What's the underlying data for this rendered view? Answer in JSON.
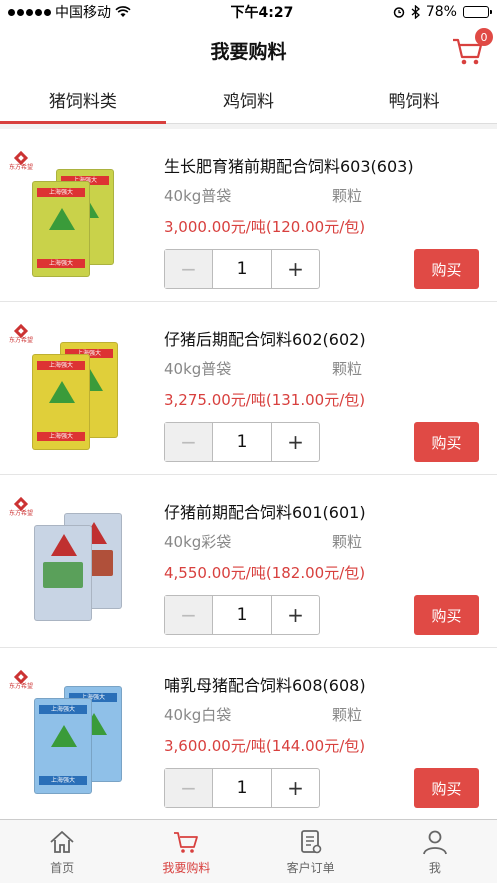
{
  "status": {
    "carrier": "中国移动",
    "time": "下午4:27",
    "battery": "78%",
    "battery_level": 0.78
  },
  "nav": {
    "title": "我要购料",
    "cart_count": "0"
  },
  "tabs": [
    {
      "label": "猪饲料类",
      "active": true
    },
    {
      "label": "鸡饲料",
      "active": false
    },
    {
      "label": "鸭饲料",
      "active": false
    }
  ],
  "products": [
    {
      "title": "生长肥育猪前期配合饲料603(603)",
      "spec": "40kg普袋",
      "form": "颗粒",
      "price": "3,000.00元/吨(120.00元/包)",
      "qty": "1",
      "buy": "购买",
      "brand": "东方希望",
      "bag_label": "上海强大",
      "bag_color": "#c9d24a"
    },
    {
      "title": "仔猪后期配合饲料602(602)",
      "spec": "40kg普袋",
      "form": "颗粒",
      "price": "3,275.00元/吨(131.00元/包)",
      "qty": "1",
      "buy": "购买",
      "brand": "东方希望",
      "bag_label": "上海强大",
      "bag_color": "#e0cf3a"
    },
    {
      "title": "仔猪前期配合饲料601(601)",
      "spec": "40kg彩袋",
      "form": "颗粒",
      "price": "4,550.00元/吨(182.00元/包)",
      "qty": "1",
      "buy": "购买",
      "brand": "东方希望",
      "bag_label": "",
      "bag_color": "#c8d4e4"
    },
    {
      "title": "哺乳母猪配合饲料608(608)",
      "spec": "40kg白袋",
      "form": "颗粒",
      "price": "3,600.00元/吨(144.00元/包)",
      "qty": "1",
      "buy": "购买",
      "brand": "东方希望",
      "bag_label": "上海强大",
      "bag_color": "#8fc0e8"
    }
  ],
  "tabbar": [
    {
      "label": "首页",
      "icon": "home-icon",
      "active": false
    },
    {
      "label": "我要购料",
      "icon": "cart-icon",
      "active": true
    },
    {
      "label": "客户订单",
      "icon": "order-icon",
      "active": false
    },
    {
      "label": "我",
      "icon": "user-icon",
      "active": false
    }
  ],
  "colors": {
    "accent": "#d8403e",
    "buy_button": "#e04a45"
  }
}
